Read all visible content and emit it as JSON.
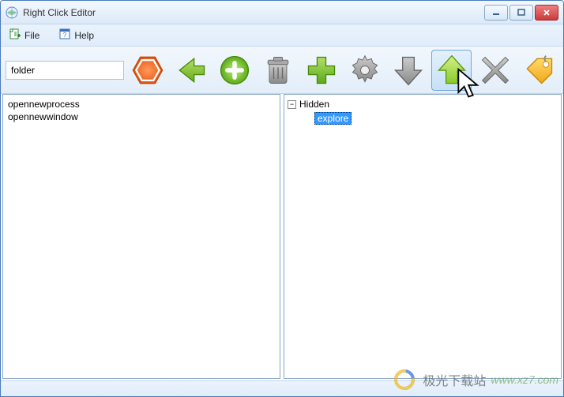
{
  "window": {
    "title": "Right Click Editor"
  },
  "menu": {
    "file": "File",
    "help": "Help"
  },
  "toolbar": {
    "path_value": "folder"
  },
  "left_list": {
    "items": [
      "opennewprocess",
      "opennewwindow"
    ]
  },
  "right_tree": {
    "root": "Hidden",
    "expanded": true,
    "child_selected": "explore"
  },
  "watermark": {
    "brand": "极光下载站",
    "url": "www.xz7.com"
  }
}
